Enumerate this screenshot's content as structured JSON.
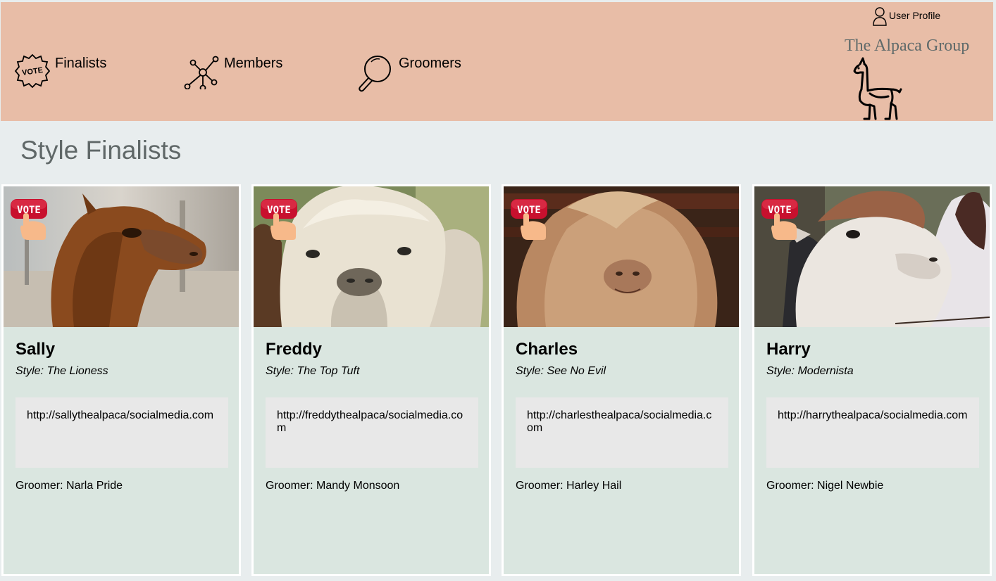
{
  "nav": {
    "items": [
      {
        "label": "Finalists",
        "icon": "vote-badge-icon"
      },
      {
        "label": "Members",
        "icon": "network-icon"
      },
      {
        "label": "Groomers",
        "icon": "search-icon"
      }
    ]
  },
  "header": {
    "user_profile_label": "User Profile",
    "brand": "The Alpaca Group",
    "logo_icon": "alpaca-logo-icon",
    "background": "#e8bda7"
  },
  "main": {
    "title": "Style Finalists"
  },
  "vote_badge_text": "VOTE",
  "cards": [
    {
      "name": "Sally",
      "style": "Style: The Lioness",
      "link": "http://sallythealpaca/socialmedia.com",
      "groomer": "Groomer: Narla Pride",
      "photo": "brown alpaca profile"
    },
    {
      "name": "Freddy",
      "style": "Style: The Top Tuft",
      "link": "http://freddythealpaca/socialmedia.com",
      "groomer": "Groomer: Mandy Monsoon",
      "photo": "cream alpaca face"
    },
    {
      "name": "Charles",
      "style": "Style: See No Evil",
      "link": "http://charlesthealpaca/socialmedia.com",
      "groomer": "Groomer: Harley Hail",
      "photo": "shaggy tan alpaca"
    },
    {
      "name": "Harry",
      "style": "Style: Modernista",
      "link": "http://harrythealpaca/socialmedia.com",
      "groomer": "Groomer: Nigel Newbie",
      "photo": "white alpaca with brown top"
    }
  ],
  "colors": {
    "page_bg": "#e8edee",
    "card_bg": "#dae6e0",
    "link_box_bg": "#e8e8e8",
    "vote_red": "#c8102e",
    "hand": "#f7b98a"
  }
}
